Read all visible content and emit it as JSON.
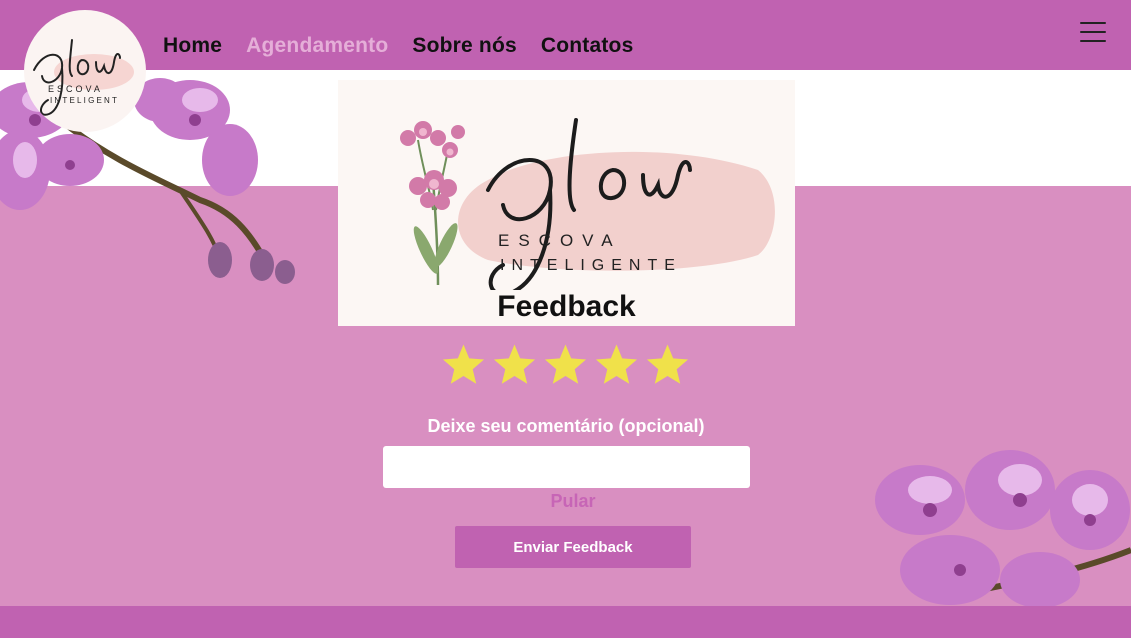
{
  "nav": {
    "items": [
      {
        "label": "Home",
        "active": false
      },
      {
        "label": "Agendamento",
        "active": true
      },
      {
        "label": "Sobre nós",
        "active": false
      },
      {
        "label": "Contatos",
        "active": false
      }
    ],
    "menu_icon": "hamburger-menu-icon"
  },
  "logo": {
    "script": "glow",
    "line1": "ESCOVA",
    "line2_header": "INTELIGENT",
    "line2": "INTELIGENTE"
  },
  "feedback": {
    "title": "Feedback",
    "rating": 5,
    "max_rating": 5,
    "comment_label": "Deixe seu comentário (opcional)",
    "comment_value": "",
    "skip_label": "Pular",
    "submit_label": "Enviar Feedback"
  },
  "colors": {
    "header": "#c062b1",
    "background": "#d98fc1",
    "star": "#f0e14a",
    "accent": "#c765b6"
  }
}
